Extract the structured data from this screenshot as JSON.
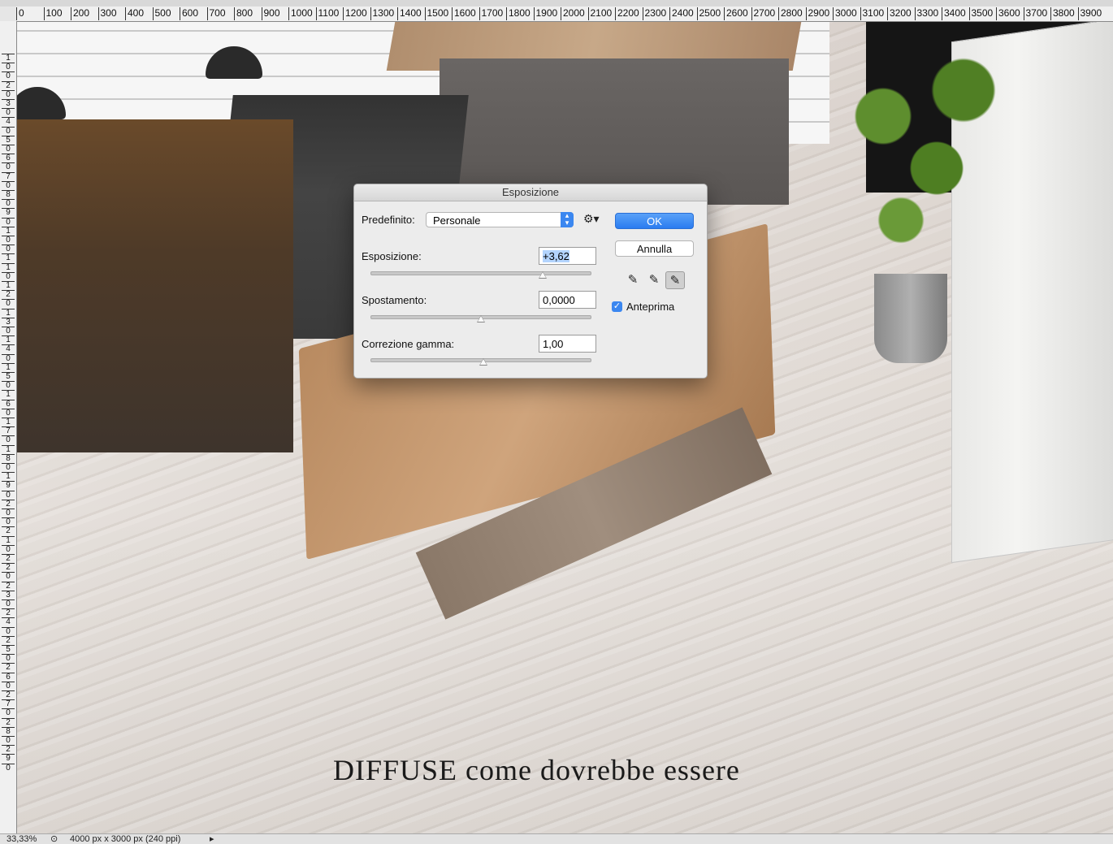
{
  "rulers": {
    "top_labels": [
      "0",
      "100",
      "200",
      "300",
      "400",
      "500",
      "600",
      "700",
      "800",
      "900",
      "1000",
      "1100",
      "1200",
      "1300",
      "1400",
      "1500",
      "1600",
      "1700",
      "1800",
      "1900",
      "2000",
      "2100",
      "2200",
      "2300",
      "2400",
      "2500",
      "2600",
      "2700",
      "2800",
      "2900",
      "3000",
      "3100",
      "3200",
      "3300",
      "3400",
      "3500",
      "3600",
      "3700",
      "3800",
      "3900"
    ],
    "left_labels": [
      "1",
      "0",
      "0",
      "2",
      "0",
      "3",
      "0",
      "4",
      "0",
      "5",
      "0",
      "6",
      "0",
      "7",
      "0",
      "8",
      "0",
      "9",
      "0",
      "1",
      "0",
      "0",
      "1",
      "1",
      "0",
      "1",
      "2",
      "0",
      "1",
      "3",
      "0",
      "1",
      "4",
      "0",
      "1",
      "5",
      "0",
      "1",
      "6",
      "0",
      "1",
      "7",
      "0",
      "1",
      "8",
      "0",
      "1",
      "9",
      "0",
      "2",
      "0",
      "0",
      "2",
      "1",
      "0",
      "2",
      "2",
      "0",
      "2",
      "3",
      "0",
      "2",
      "4",
      "0",
      "2",
      "5",
      "0",
      "2",
      "6",
      "0",
      "2",
      "7",
      "0",
      "2",
      "8",
      "0",
      "2",
      "9",
      "0"
    ]
  },
  "canvas": {
    "caption": "DIFFUSE come dovrebbe essere"
  },
  "statusbar": {
    "zoom": "33,33%",
    "doc_info": "4000 px x 3000 px (240 ppi)"
  },
  "dialog": {
    "title": "Esposizione",
    "preset_label": "Predefinito:",
    "preset_value": "Personale",
    "ok_label": "OK",
    "cancel_label": "Annulla",
    "preview_label": "Anteprima",
    "preview_checked": true,
    "exposure": {
      "label": "Esposizione:",
      "value": "+3,62",
      "slider": 0.78
    },
    "offset": {
      "label": "Spostamento:",
      "value": "0,0000",
      "slider": 0.5
    },
    "gamma": {
      "label": "Correzione gamma:",
      "value": "1,00",
      "slider": 0.51
    },
    "icons": [
      "settings-gear-icon",
      "eyedropper-black-icon",
      "eyedropper-gray-icon",
      "eyedropper-white-icon"
    ]
  }
}
